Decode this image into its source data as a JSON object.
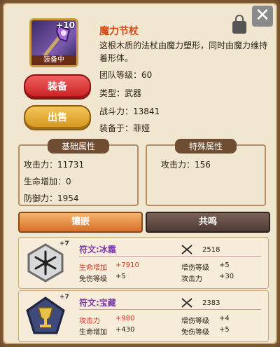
{
  "item": {
    "level_badge": "+10",
    "equipped_label": "装备中",
    "name": "魔力节杖",
    "description": "这根木质的法杖由魔力塑形，同时由魔力维持着形体。",
    "stats": [
      {
        "label": "团队等级：",
        "value": "60"
      },
      {
        "label": "类型：",
        "value": "武器"
      },
      {
        "label": "战斗力：",
        "value": "13841"
      },
      {
        "label": "装备于：",
        "value": "菲娅"
      }
    ]
  },
  "buttons": {
    "equip": "装备",
    "sell": "出售",
    "close": "✕"
  },
  "base_attributes": {
    "title": "基础属性",
    "lines": [
      "攻击力：11731",
      "生命增加：0",
      "防御力：1954"
    ]
  },
  "special_attributes": {
    "title": "特殊属性",
    "lines": [
      "攻击力：156"
    ]
  },
  "tabs": {
    "inlay": "镶嵌",
    "resonance": "共鸣"
  },
  "runes": [
    {
      "badge": "+7",
      "name": "符文:冰霜",
      "power": "2518",
      "left": [
        {
          "label": "生命增加",
          "value": "+7910",
          "highlight": true
        },
        {
          "label": "免伤等级",
          "value": "+5",
          "highlight": false
        }
      ],
      "right": [
        {
          "label": "增伤等级",
          "value": "+5"
        },
        {
          "label": "攻击力",
          "value": "+30"
        }
      ]
    },
    {
      "badge": "+7",
      "name": "符文:宝藏",
      "power": "2383",
      "left": [
        {
          "label": "攻击力",
          "value": "+980",
          "highlight": true
        },
        {
          "label": "生命增加",
          "value": "+430",
          "highlight": false
        }
      ],
      "right": [
        {
          "label": "增伤等级",
          "value": "+4"
        },
        {
          "label": "免伤等级",
          "value": "+5"
        }
      ]
    }
  ],
  "icons": {
    "close": "close-icon",
    "lock": "lock-icon",
    "staff": "staff-icon",
    "snowflake": "snowflake-icon",
    "chalice": "chalice-icon",
    "swords": "crossed-swords-icon"
  }
}
